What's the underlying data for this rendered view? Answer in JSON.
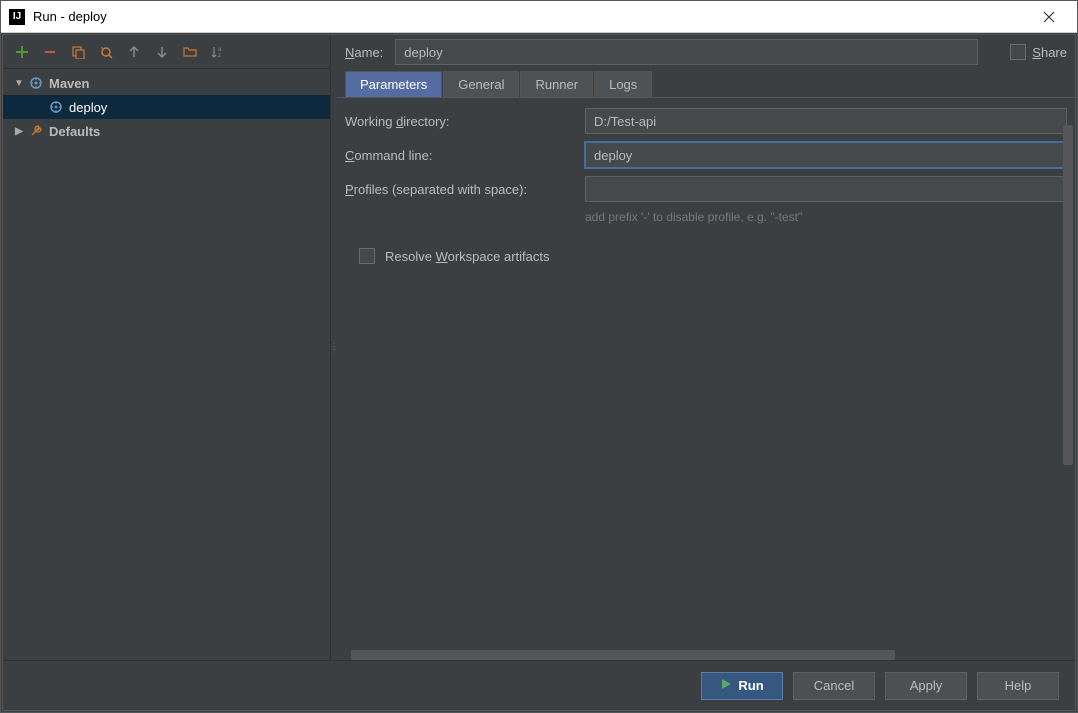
{
  "window": {
    "title": "Run - deploy"
  },
  "nameField": {
    "label": "Name:",
    "value": "deploy"
  },
  "shareLabel": "Share",
  "tree": {
    "maven": "Maven",
    "deploy": "deploy",
    "defaults": "Defaults"
  },
  "tabs": {
    "parameters": "Parameters",
    "general": "General",
    "runner": "Runner",
    "logs": "Logs"
  },
  "form": {
    "workingDirLabel": "Working directory:",
    "workingDirValue": "D:/Test-api",
    "commandLineLabel": "Command line:",
    "commandLineValue": "deploy",
    "profilesLabel": "Profiles (separated with space):",
    "profilesValue": "",
    "profilesHint": "add prefix '-' to disable profile, e.g. \"-test\"",
    "resolveLabel": "Resolve Workspace artifacts"
  },
  "buttons": {
    "run": "Run",
    "cancel": "Cancel",
    "apply": "Apply",
    "help": "Help"
  }
}
